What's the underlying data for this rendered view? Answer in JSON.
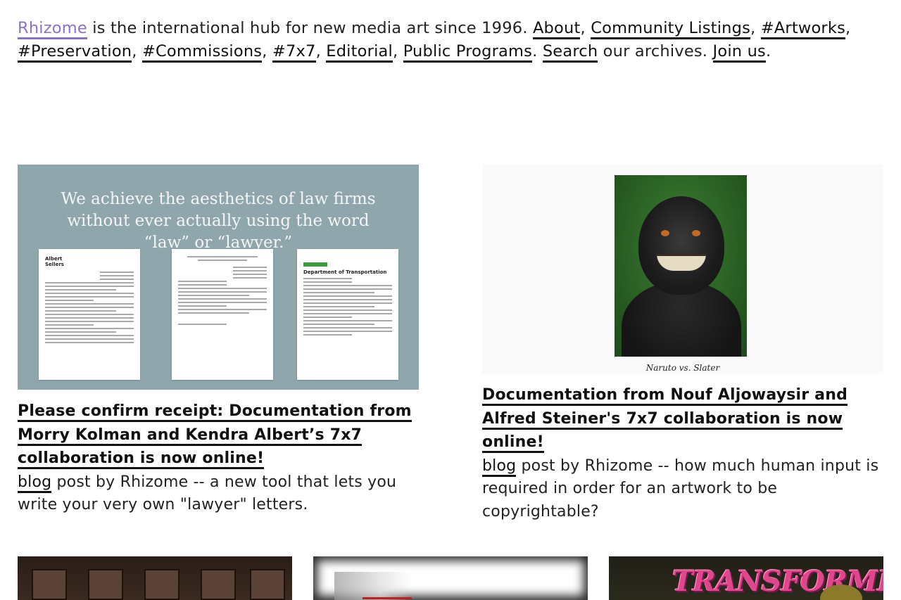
{
  "intro": {
    "brand": "Rhizome",
    "tagline": " is the international hub for new media art since 1996. ",
    "links": [
      "About",
      "Community Listings",
      "#Artworks",
      "#Preservation",
      "#Commissions",
      "#7x7",
      "Editorial",
      "Public Programs"
    ],
    "search_label": "Search",
    "search_suffix": " our archives. ",
    "join_label": "Join us"
  },
  "posts": [
    {
      "image_quote": "We achieve the aesthetics of law firms without ever actually using the word “law” or “lawyer.”",
      "letter1_logo": "Albert Sellers",
      "letter3_head": "Department of Transportation",
      "title": "Please confirm receipt: Documentation from Morry Kolman and Kendra Albert’s 7x7 collaboration is now online!",
      "category": "blog",
      "description": " post by Rhizome -- a new tool that lets you write your very own \"lawyer\" letters."
    },
    {
      "image_caption": "Naruto vs. Slater",
      "title": "Documentation from Nouf Aljowaysir and Alfred Steiner's 7x7 collaboration is now online!",
      "category": "blog",
      "description": " post by Rhizome -- how much human input is required in order for an artwork to be copyrightable?"
    }
  ],
  "bottom_row": {
    "third_thumb_text": "TRANSFORMERS"
  }
}
